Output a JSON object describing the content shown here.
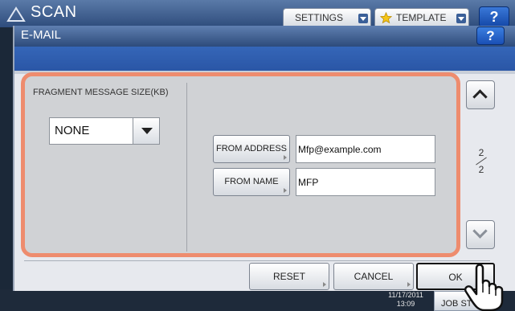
{
  "background": {
    "title": "SCAN",
    "settings_label": "SETTINGS",
    "template_label": "TEMPLATE",
    "help_label": "?",
    "date": "11/17/2011",
    "time": "13:09",
    "job_status_label": "JOB ST"
  },
  "dialog": {
    "title": "E-MAIL",
    "help_label": "?",
    "fragment_label": "FRAGMENT MESSAGE SIZE(KB)",
    "fragment_value": "NONE",
    "from_address_label": "FROM ADDRESS",
    "from_address_value": "Mfp@example.com",
    "from_name_label": "FROM NAME",
    "from_name_value": "MFP",
    "page_current": "2",
    "page_total": "2",
    "reset_label": "RESET",
    "cancel_label": "CANCEL",
    "ok_label": "OK"
  },
  "colors": {
    "highlight_border": "#ee8c6e",
    "header_blue": "#2d4b7b",
    "help_blue": "#1a4fb5"
  }
}
